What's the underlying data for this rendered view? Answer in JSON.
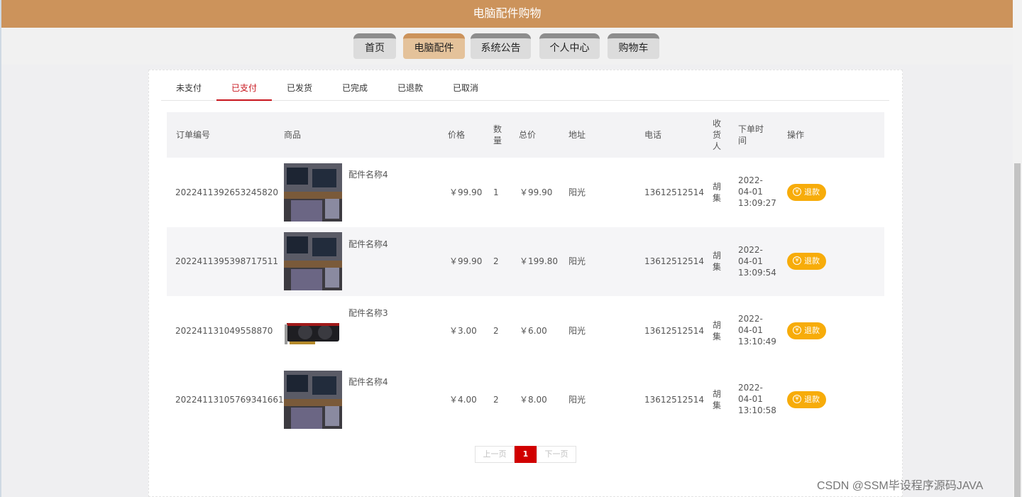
{
  "header": {
    "title": "电脑配件购物"
  },
  "nav": [
    {
      "label": "首页",
      "active": false
    },
    {
      "label": "电脑配件",
      "active": true
    },
    {
      "label": "系统公告",
      "active": false
    },
    {
      "label": "个人中心",
      "active": false
    },
    {
      "label": "购物车",
      "active": false
    }
  ],
  "tabs": [
    {
      "label": "未支付",
      "active": false
    },
    {
      "label": "已支付",
      "active": true
    },
    {
      "label": "已发货",
      "active": false
    },
    {
      "label": "已完成",
      "active": false
    },
    {
      "label": "已退款",
      "active": false
    },
    {
      "label": "已取消",
      "active": false
    }
  ],
  "table": {
    "headers": {
      "order_no": "订单编号",
      "product": "商品",
      "price": "价格",
      "qty": [
        "数",
        "量"
      ],
      "total": "总价",
      "address": "地址",
      "phone": "电话",
      "receiver": [
        "收",
        "货",
        "人"
      ],
      "order_time": [
        "下单时",
        "间"
      ],
      "action": "操作"
    },
    "rows": [
      {
        "order_no": "2022411392653245820",
        "product_name": "配件名称4",
        "image": "computer-desk-photo",
        "price": "￥99.90",
        "qty": "1",
        "total": "￥99.90",
        "address": "阳光",
        "phone": "13612512514",
        "receiver": [
          "胡",
          "集"
        ],
        "time": [
          "2022-",
          "04-01",
          "13:09:27"
        ],
        "action_label": "退款"
      },
      {
        "order_no": "2022411395398717511",
        "product_name": "配件名称4",
        "image": "computer-desk-photo",
        "price": "￥99.90",
        "qty": "2",
        "total": "￥199.80",
        "address": "阳光",
        "phone": "13612512514",
        "receiver": [
          "胡",
          "集"
        ],
        "time": [
          "2022-",
          "04-01",
          "13:09:54"
        ],
        "action_label": "退款"
      },
      {
        "order_no": "202241131049558870",
        "product_name": "配件名称3",
        "image": "graphics-card-photo",
        "price": "￥3.00",
        "qty": "2",
        "total": "￥6.00",
        "address": "阳光",
        "phone": "13612512514",
        "receiver": [
          "胡",
          "集"
        ],
        "time": [
          "2022-",
          "04-01",
          "13:10:49"
        ],
        "action_label": "退款"
      },
      {
        "order_no": "20224113105769341661",
        "product_name": "配件名称4",
        "image": "computer-desk-photo",
        "price": "￥4.00",
        "qty": "2",
        "total": "￥8.00",
        "address": "阳光",
        "phone": "13612512514",
        "receiver": [
          "胡",
          "集"
        ],
        "time": [
          "2022-",
          "04-01",
          "13:10:58"
        ],
        "action_label": "退款"
      }
    ]
  },
  "pagination": {
    "prev": "上一页",
    "current": "1",
    "next": "下一页"
  },
  "watermark": "CSDN @SSM毕设程序源码JAVA",
  "icons": {
    "refund": "yen-circle-icon"
  },
  "colors": {
    "header": "#cc935b",
    "active_nav": "#e4c29a",
    "active_tab": "#c8161d",
    "refund_button": "#f7ac0a",
    "current_page": "#d10000"
  }
}
